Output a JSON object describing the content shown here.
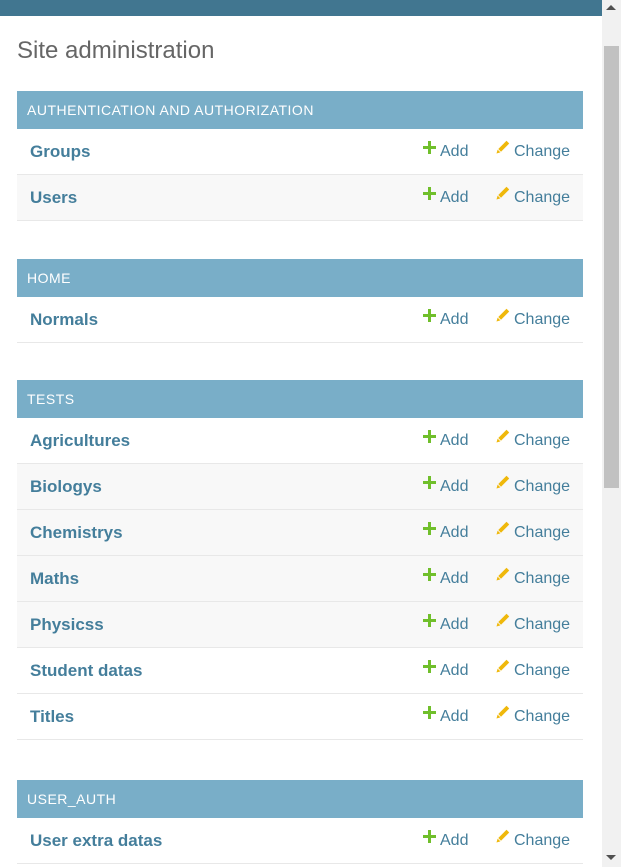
{
  "page": {
    "title": "Site administration"
  },
  "labels": {
    "add": "Add",
    "change": "Change"
  },
  "icons": {
    "add": "plus-icon",
    "change": "pencil-icon"
  },
  "colors": {
    "header_bar": "#417690",
    "module_header": "#79aec8",
    "link": "#447e9b",
    "add_icon": "#70bf2b",
    "change_icon": "#efb80b"
  },
  "modules": [
    {
      "name": "AUTHENTICATION AND AUTHORIZATION",
      "models": [
        "Groups",
        "Users"
      ]
    },
    {
      "name": "HOME",
      "models": [
        "Normals"
      ]
    },
    {
      "name": "TESTS",
      "models": [
        "Agricultures",
        "Biologys",
        "Chemistrys",
        "Maths",
        "Physicss",
        "Student datas",
        "Titles"
      ]
    },
    {
      "name": "USER_AUTH",
      "models": [
        "User extra datas"
      ]
    }
  ]
}
